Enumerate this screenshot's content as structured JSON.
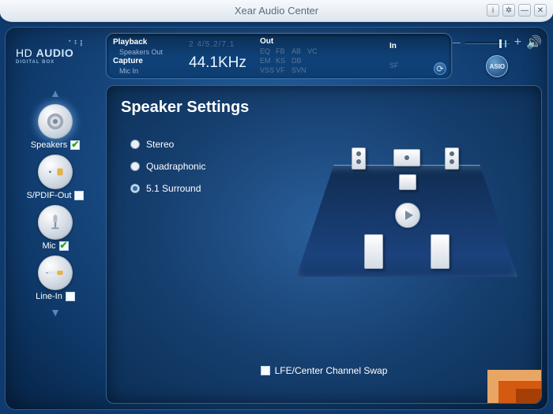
{
  "window": {
    "title": "Xear Audio Center"
  },
  "logo": {
    "line1_a": "HD",
    "line1_b": "AUDIO",
    "line2": "DIGITAL BOX"
  },
  "status": {
    "playback_label": "Playback",
    "playback_device": "Speakers Out",
    "capture_label": "Capture",
    "capture_device": "Mic In",
    "channels": "2 4/5.2/7.1",
    "sample_rate": "44.1KHz",
    "out_label": "Out",
    "in_label": "In",
    "fx_out": [
      "EQ",
      "FB",
      "AB",
      "VC",
      "EM",
      "KS",
      "DB",
      "",
      "VSS",
      "VF",
      "SVN",
      ""
    ],
    "fx_in": [
      "SF"
    ]
  },
  "sidebar": {
    "items": [
      {
        "label": "Speakers",
        "checked": true,
        "selected": true
      },
      {
        "label": "S/PDIF-Out",
        "checked": false,
        "selected": false
      },
      {
        "label": "Mic",
        "checked": true,
        "selected": false
      },
      {
        "label": "Line-In",
        "checked": false,
        "selected": false
      }
    ]
  },
  "panel": {
    "title": "Speaker Settings",
    "radios": [
      {
        "label": "Stereo",
        "selected": false
      },
      {
        "label": "Quadraphonic",
        "selected": false
      },
      {
        "label": "5.1 Surround",
        "selected": true
      }
    ],
    "lfe_label": "LFE/Center Channel Swap",
    "lfe_checked": false
  },
  "volume": {
    "level_pct": 80
  },
  "asio": {
    "label": "ASIO"
  }
}
